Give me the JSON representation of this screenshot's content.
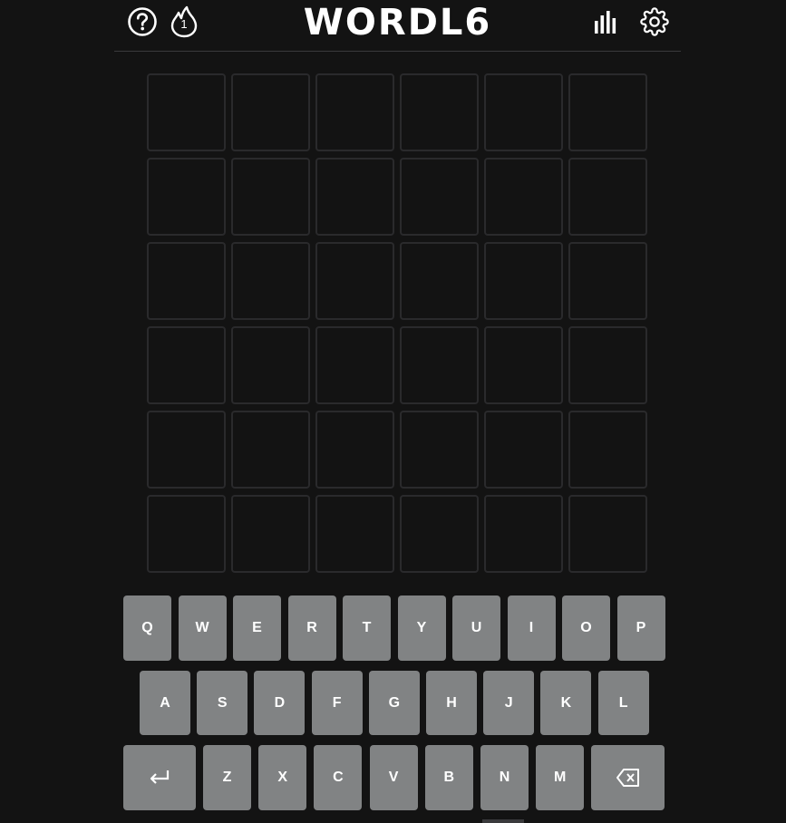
{
  "header": {
    "title": "WORDL6",
    "streak_count": "1",
    "icons": [
      "help-icon",
      "streak-flame-icon",
      "statistics-icon",
      "settings-icon"
    ]
  },
  "board": {
    "rows": [
      [
        "",
        "",
        "",
        "",
        "",
        ""
      ],
      [
        "",
        "",
        "",
        "",
        "",
        ""
      ],
      [
        "",
        "",
        "",
        "",
        "",
        ""
      ],
      [
        "",
        "",
        "",
        "",
        "",
        ""
      ],
      [
        "",
        "",
        "",
        "",
        "",
        ""
      ],
      [
        "",
        "",
        "",
        "",
        "",
        ""
      ]
    ]
  },
  "keyboard": {
    "row1": [
      "Q",
      "W",
      "E",
      "R",
      "T",
      "Y",
      "U",
      "I",
      "O",
      "P"
    ],
    "row2": [
      "A",
      "S",
      "D",
      "F",
      "G",
      "H",
      "J",
      "K",
      "L"
    ],
    "row3": [
      "Z",
      "X",
      "C",
      "V",
      "B",
      "N",
      "M"
    ],
    "enter_icon": "enter-icon",
    "backspace_icon": "backspace-icon"
  },
  "colors": {
    "background": "#131313",
    "tile_border": "#2a2a2c",
    "key": "#818384",
    "text": "#ffffff"
  }
}
